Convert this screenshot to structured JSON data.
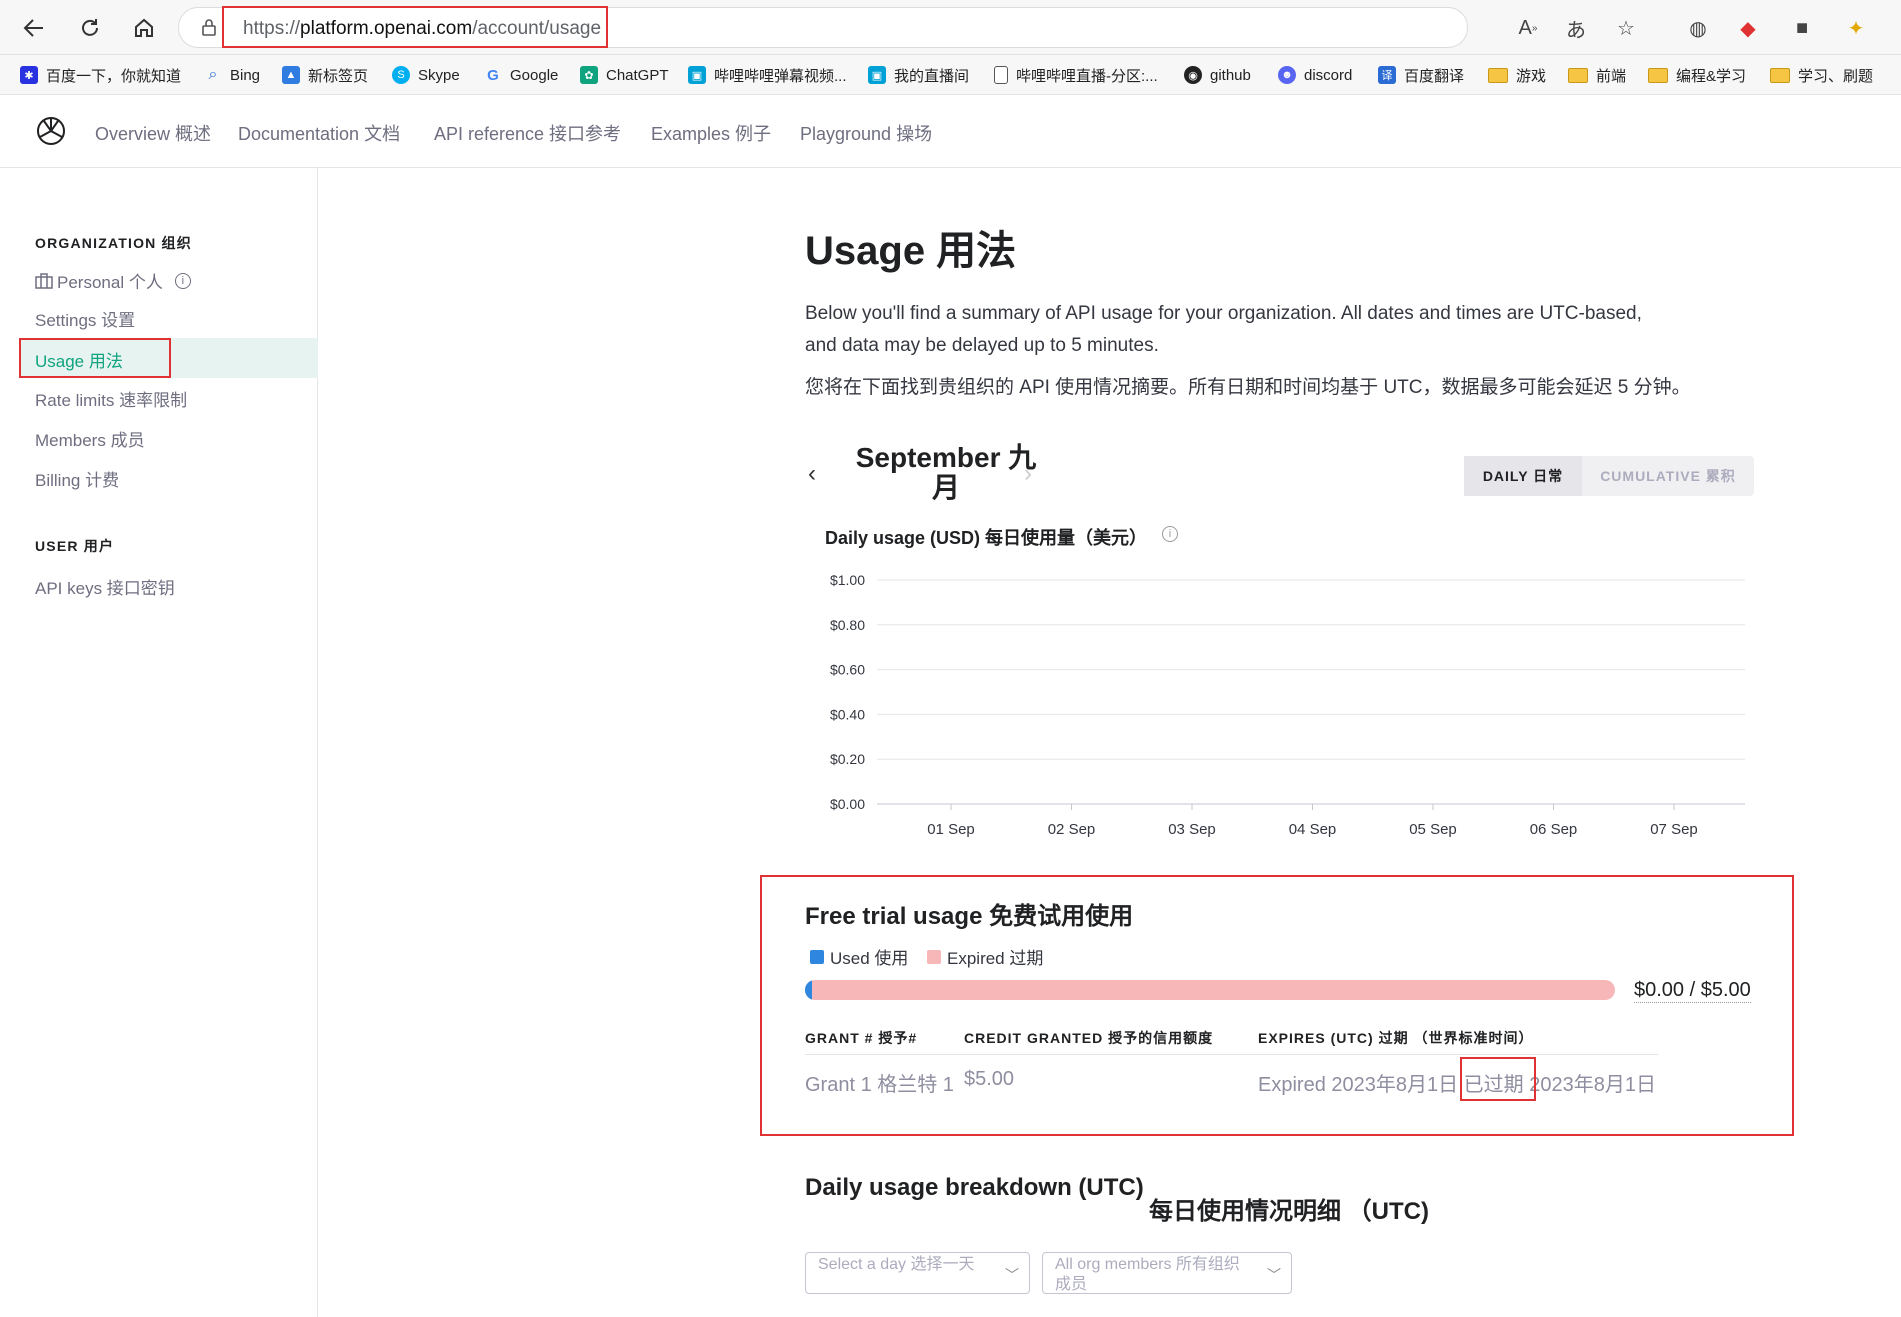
{
  "browser": {
    "url_prefix": "https://",
    "url_host": "platform.openai.com",
    "url_path": "/account/usage",
    "bookmarks": [
      {
        "label": "百度一下，你就知道",
        "icon": "baidu-icon"
      },
      {
        "label": "Bing",
        "icon": "bing-search-icon"
      },
      {
        "label": "新标签页",
        "icon": "newtab-icon"
      },
      {
        "label": "Skype",
        "icon": "skype-icon"
      },
      {
        "label": "Google",
        "icon": "google-icon"
      },
      {
        "label": "ChatGPT",
        "icon": "chatgpt-icon"
      },
      {
        "label": "哔哩哔哩弹幕视频...",
        "icon": "bilibili-icon"
      },
      {
        "label": "我的直播间",
        "icon": "bilibili-icon"
      },
      {
        "label": "哔哩哔哩直播-分区:...",
        "icon": "page-icon"
      },
      {
        "label": "github",
        "icon": "github-icon"
      },
      {
        "label": "discord",
        "icon": "discord-icon"
      },
      {
        "label": "百度翻译",
        "icon": "translate-icon"
      },
      {
        "label": "游戏",
        "icon": "folder-icon"
      },
      {
        "label": "前端",
        "icon": "folder-icon"
      },
      {
        "label": "编程&学习",
        "icon": "folder-icon"
      },
      {
        "label": "学习、刷题",
        "icon": "folder-icon"
      }
    ]
  },
  "topnav": {
    "items": [
      "Overview 概述",
      "Documentation 文档",
      "API reference 接口参考",
      "Examples 例子",
      "Playground 操场"
    ]
  },
  "sidebar": {
    "org_title": "ORGANIZATION 组织",
    "org_items": [
      "Personal 个人",
      "Settings 设置",
      "Usage 用法",
      "Rate limits 速率限制",
      "Members 成员",
      "Billing 计费"
    ],
    "user_title": "USER 用户",
    "user_items": [
      "API keys 接口密钥"
    ]
  },
  "main": {
    "title": "Usage 用法",
    "desc_line1": "Below you'll find a summary of API usage for your organization. All dates and times are UTC-based,",
    "desc_line2": "and data may be delayed up to 5 minutes.",
    "desc_line3": "您将在下面找到贵组织的 API 使用情况摘要。所有日期和时间均基于 UTC，数据最多可能会延迟 5 分钟。",
    "month": "September 九月",
    "toggle_daily": "DAILY 日常",
    "toggle_cumulative": "CUMULATIVE 累积"
  },
  "chart_data": {
    "type": "bar",
    "title": "Daily usage (USD) 每日使用量（美元）",
    "categories": [
      "01 Sep",
      "02 Sep",
      "03 Sep",
      "04 Sep",
      "05 Sep",
      "06 Sep",
      "07 Sep"
    ],
    "values": [
      0,
      0,
      0,
      0,
      0,
      0,
      0
    ],
    "ytick_labels": [
      "$0.00",
      "$0.20",
      "$0.40",
      "$0.60",
      "$0.80",
      "$1.00"
    ],
    "ylim": [
      0,
      1
    ],
    "grid": true
  },
  "free_trial": {
    "title": "Free trial usage 免费试用使用",
    "legend_used": "Used 使用",
    "legend_expired": "Expired 过期",
    "used_color": "#2e86de",
    "expired_color": "#f7b6b8",
    "used_amount": 0,
    "total_amount": 5,
    "amount_label": "$0.00 / $5.00",
    "col_grant": "GRANT # 授予#",
    "col_credit": "CREDIT GRANTED 授予的信用额度",
    "col_expires": "EXPIRES (UTC) 过期 （世界标准时间）",
    "row": {
      "grant": "Grant 1 格兰特 1",
      "credit": "$5.00",
      "expires": "Expired 2023年8月1日 已过期 2023年8月1日"
    }
  },
  "breakdown": {
    "title_en": "Daily usage breakdown (UTC)",
    "title_zh": "每日使用情况明细 （UTC)",
    "select_day": "Select a day 选择一天",
    "select_members": "All org members 所有组织成员"
  }
}
